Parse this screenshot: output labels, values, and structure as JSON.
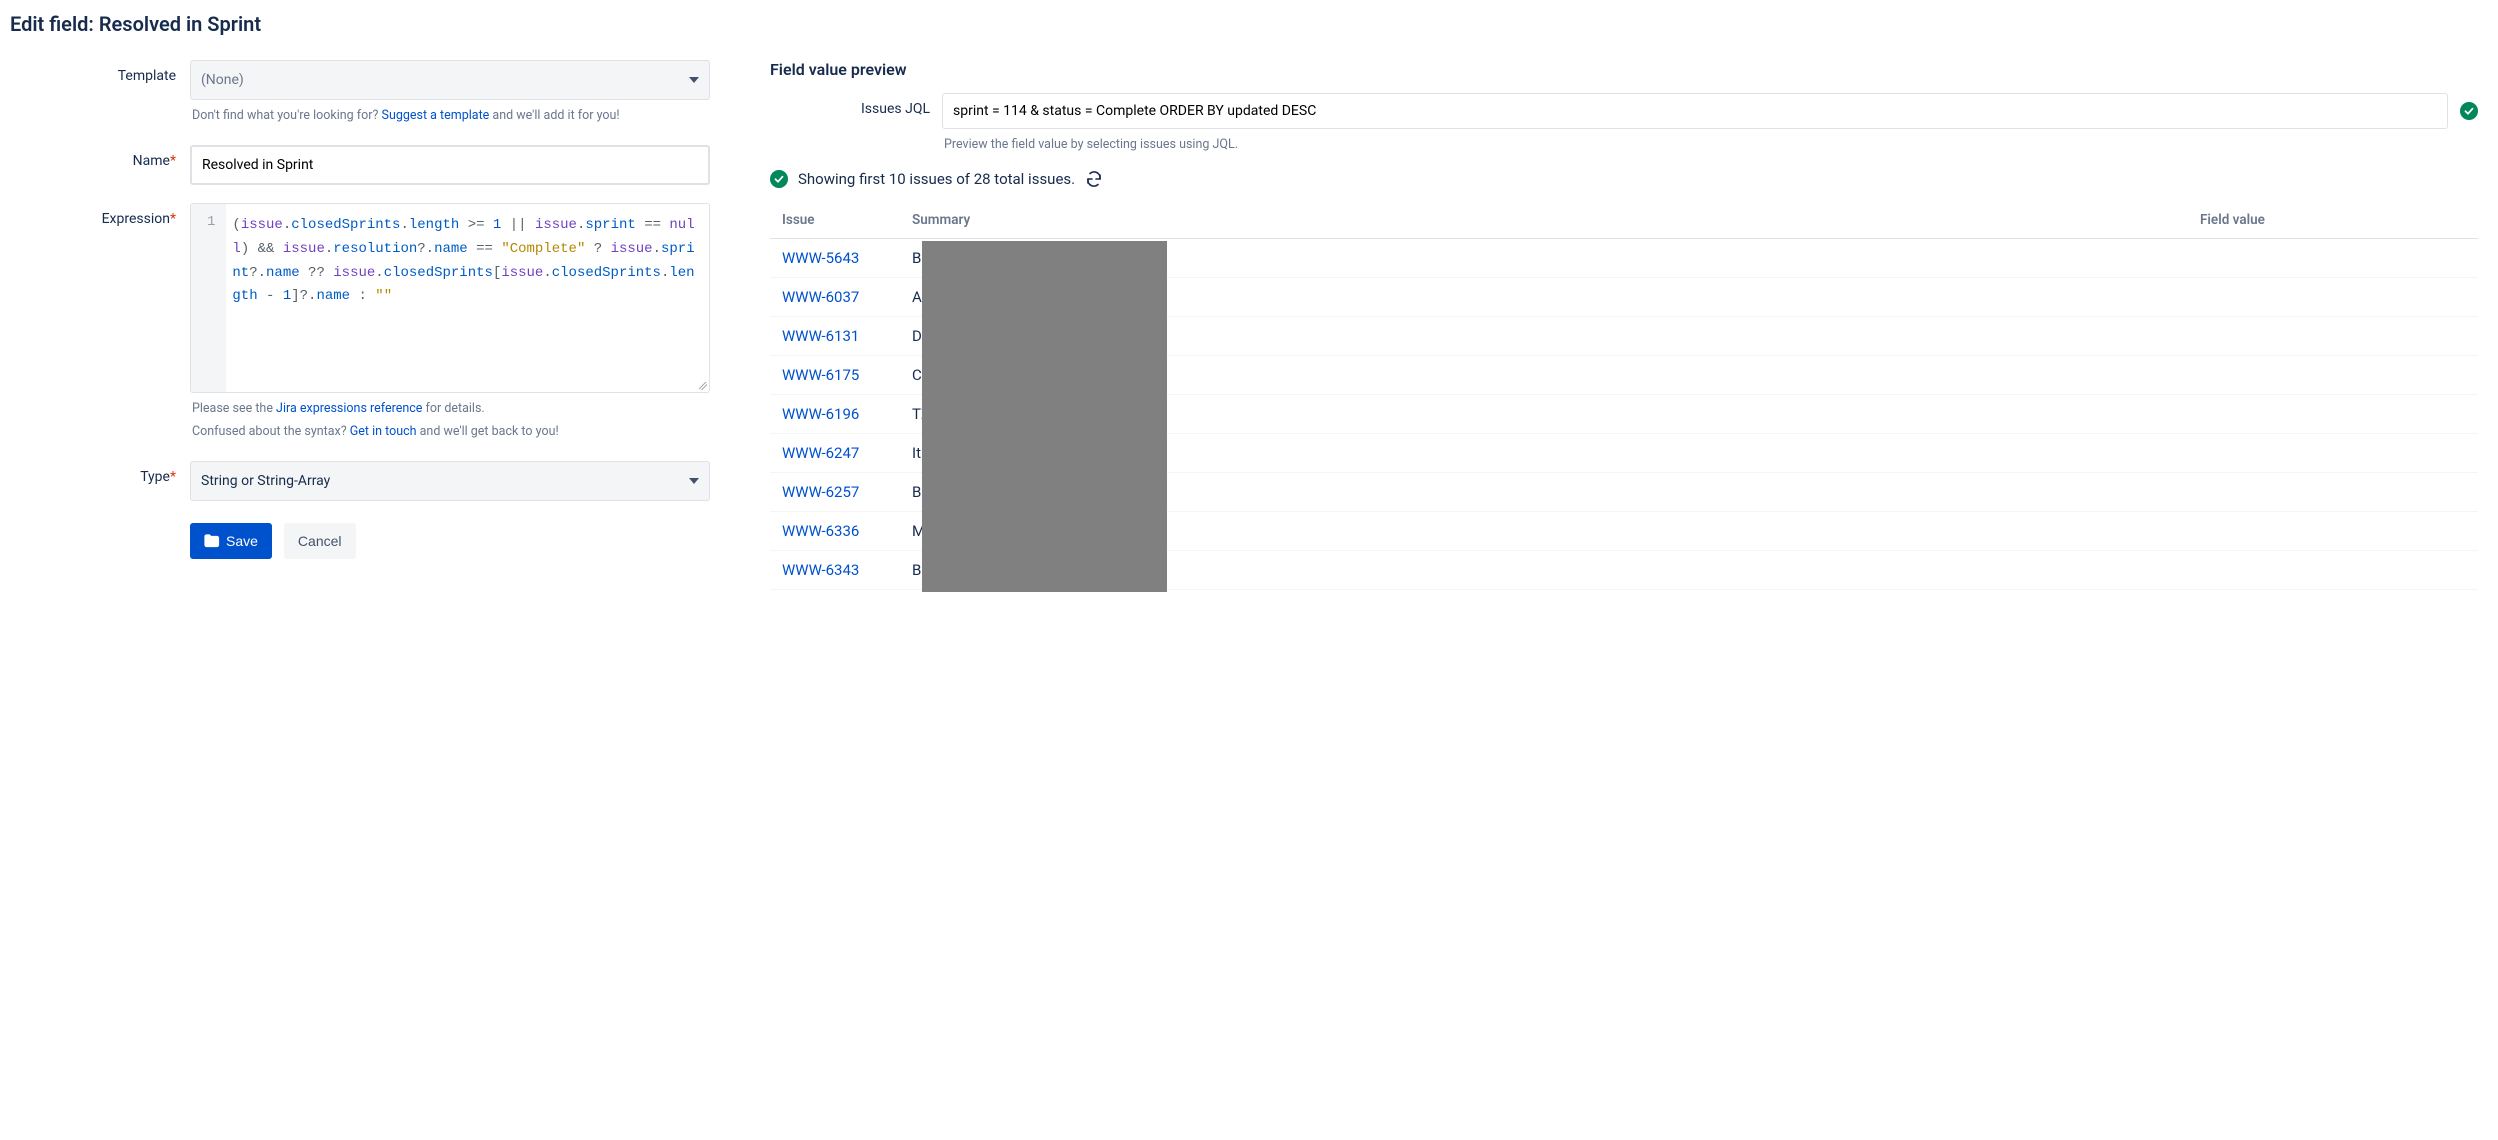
{
  "page_title": "Edit field: Resolved in Sprint",
  "left": {
    "template": {
      "label": "Template",
      "value": "(None)",
      "help_prefix": "Don't find what you're looking for? ",
      "help_link": "Suggest a template",
      "help_suffix": " and we'll add it for you!"
    },
    "name": {
      "label": "Name",
      "value": "Resolved in Sprint"
    },
    "expression": {
      "label": "Expression",
      "gutter": "1",
      "help1_prefix": "Please see the ",
      "help1_link": "Jira expressions reference",
      "help1_suffix": " for details.",
      "help2_prefix": "Confused about the syntax? ",
      "help2_link": "Get in touch",
      "help2_suffix": " and we'll get back to you!"
    },
    "type": {
      "label": "Type",
      "value": "String or String-Array"
    },
    "buttons": {
      "save": "Save",
      "cancel": "Cancel"
    }
  },
  "preview": {
    "title": "Field value preview",
    "jql_label": "Issues JQL",
    "jql_value": "sprint = 114 & status = Complete ORDER BY updated DESC",
    "jql_help": "Preview the field value by selecting issues using JQL.",
    "showing": "Showing first 10 issues of 28 total issues.",
    "columns": {
      "issue": "Issue",
      "summary": "Summary",
      "field_value": "Field value"
    },
    "rows": [
      {
        "issue": "WWW-5643",
        "summary": "Ba"
      },
      {
        "issue": "WWW-6037",
        "summary": "Ad"
      },
      {
        "issue": "WWW-6131",
        "summary": "De"
      },
      {
        "issue": "WWW-6175",
        "summary": "Cu"
      },
      {
        "issue": "WWW-6196",
        "summary": "TZ"
      },
      {
        "issue": "WWW-6247",
        "summary": "Itin"
      },
      {
        "issue": "WWW-6257",
        "summary": "BE"
      },
      {
        "issue": "WWW-6336",
        "summary": "Ma"
      },
      {
        "issue": "WWW-6343",
        "summary": "BE"
      }
    ]
  }
}
